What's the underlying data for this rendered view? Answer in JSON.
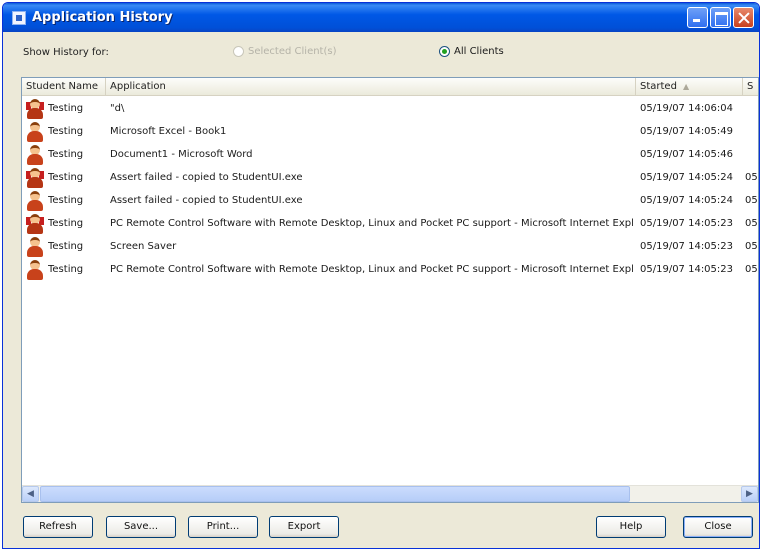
{
  "window": {
    "title": "Application History"
  },
  "filter": {
    "label": "Show History for:",
    "selected_clients_label": "Selected Client(s)",
    "all_clients_label": "All Clients",
    "selected_option": "All Clients"
  },
  "table": {
    "columns": {
      "student_name": "Student Name",
      "application": "Application",
      "started": "Started",
      "extra": "S"
    },
    "sort_column": "Started",
    "rows": [
      {
        "student": "Testing",
        "application": "\"d\\",
        "started": "05/19/07 14:06:04",
        "extra": "",
        "avatar": "alt"
      },
      {
        "student": "Testing",
        "application": "Microsoft Excel - Book1",
        "started": "05/19/07 14:05:49",
        "extra": "",
        "avatar": "plain"
      },
      {
        "student": "Testing",
        "application": "Document1 - Microsoft Word",
        "started": "05/19/07 14:05:46",
        "extra": "",
        "avatar": "plain"
      },
      {
        "student": "Testing",
        "application": "Assert failed - copied to StudentUI.exe",
        "started": "05/19/07 14:05:24",
        "extra": "05",
        "avatar": "alt"
      },
      {
        "student": "Testing",
        "application": "Assert failed - copied to StudentUI.exe",
        "started": "05/19/07 14:05:24",
        "extra": "05",
        "avatar": "plain"
      },
      {
        "student": "Testing",
        "application": "PC Remote Control Software with Remote Desktop, Linux and Pocket PC support - Microsoft Internet Explorer",
        "started": "05/19/07 14:05:23",
        "extra": "05",
        "avatar": "alt"
      },
      {
        "student": "Testing",
        "application": "Screen Saver",
        "started": "05/19/07 14:05:23",
        "extra": "05",
        "avatar": "plain"
      },
      {
        "student": "Testing",
        "application": "PC Remote Control Software with Remote Desktop, Linux and Pocket PC support - Microsoft Internet Explorer",
        "started": "05/19/07 14:05:23",
        "extra": "05",
        "avatar": "plain"
      }
    ]
  },
  "buttons": {
    "refresh": "Refresh",
    "save": "Save...",
    "print": "Print...",
    "export": "Export",
    "help": "Help",
    "close": "Close"
  },
  "colors": {
    "titlebar": "#0058e6",
    "window_bg": "#ece9d8",
    "radio_checked": "#21a121"
  }
}
